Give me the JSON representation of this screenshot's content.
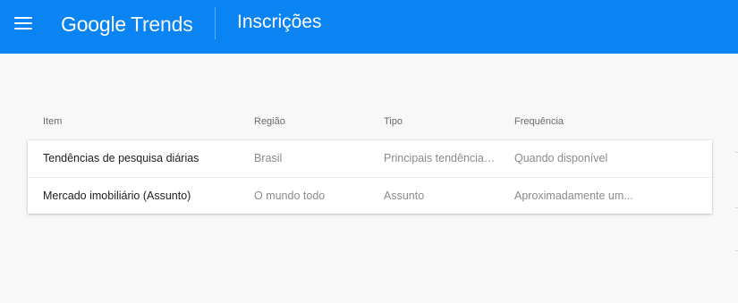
{
  "header": {
    "menu_icon": "menu-icon",
    "logo_brand": "Google",
    "logo_product": "Trends",
    "page_title": "Inscrições",
    "color": "#0a84f2"
  },
  "table": {
    "columns": [
      "Item",
      "Região",
      "Tipo",
      "Frequência"
    ],
    "rows": [
      {
        "item": "Tendências de pesquisa diárias",
        "region": "Brasil",
        "type": "Principais tendências ...",
        "frequency": "Quando disponível"
      },
      {
        "item": "Mercado imobiliário (Assunto)",
        "region": "O mundo todo",
        "type": "Assunto",
        "frequency": "Aproximadamente um..."
      }
    ]
  }
}
